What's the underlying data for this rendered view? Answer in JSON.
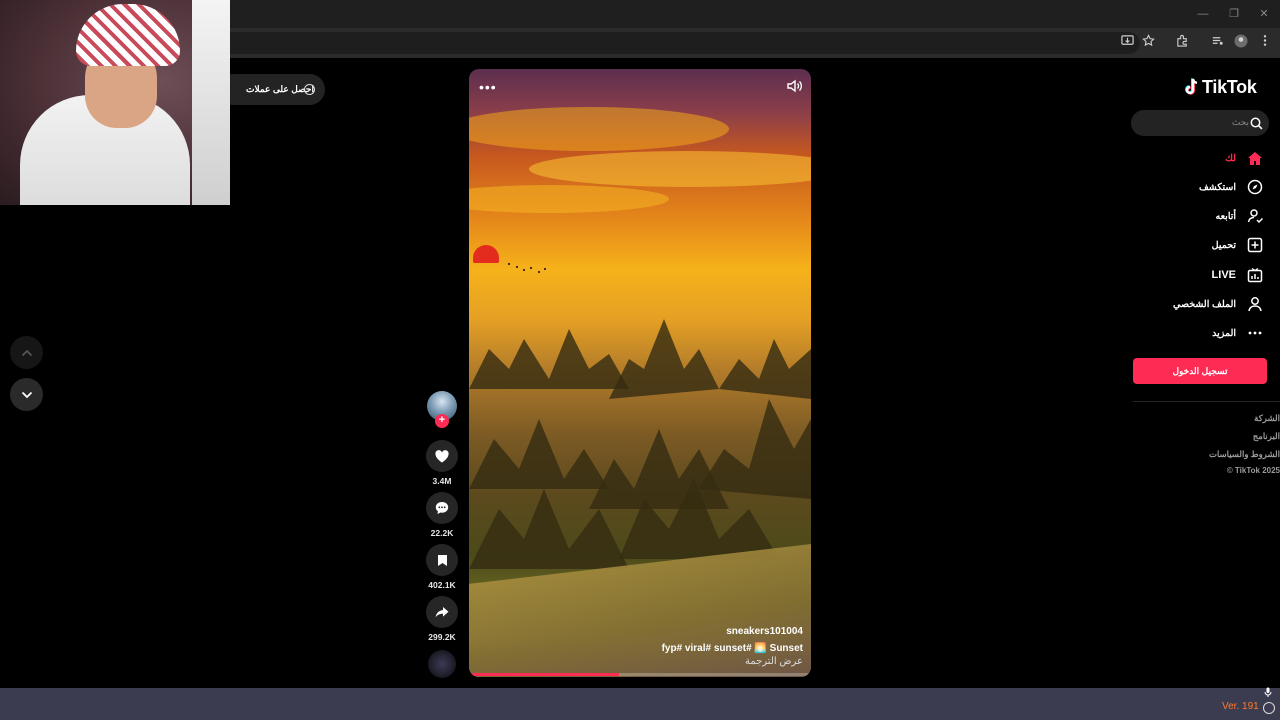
{
  "browser": {
    "window_controls": [
      "—",
      "❐",
      "✕"
    ],
    "toolbar_icons": [
      "install-app-icon",
      "star-icon",
      "extensions-icon",
      "media-icon",
      "profile-icon",
      "menu-icon"
    ]
  },
  "ads_pill": {
    "label": "احصل على عملات"
  },
  "video": {
    "author": "sneakers101004",
    "caption": "fyp#  viral#  sunset# 🌅 Sunset",
    "translate": "عرض الترجمة",
    "progress": 0.44
  },
  "actions": {
    "likes": "3.4M",
    "comments": "22.2K",
    "saves": "402.1K",
    "shares": "299.2K"
  },
  "sidebar": {
    "logo": "TikTok",
    "search_placeholder": "بحث",
    "items": [
      {
        "label": "لك",
        "icon": "home-icon",
        "active": true
      },
      {
        "label": "استكشف",
        "icon": "compass-icon"
      },
      {
        "label": "أتابعه",
        "icon": "following-icon"
      },
      {
        "label": "تحميل",
        "icon": "upload-icon"
      },
      {
        "label": "LIVE",
        "icon": "live-icon"
      },
      {
        "label": "الملف الشخصي",
        "icon": "profile-icon"
      },
      {
        "label": "المزيد",
        "icon": "more-icon"
      }
    ],
    "login": "تسجيل الدخول",
    "footer": [
      "الشركة",
      "البرنامج",
      "الشروط والسياسات",
      "© TikTok 2025"
    ]
  },
  "taskbar": {
    "version": "Ver. 191"
  },
  "colors": {
    "accent": "#fe2c55",
    "sidebar_bg": "#000000",
    "taskbar_bg": "#3c3c50"
  }
}
